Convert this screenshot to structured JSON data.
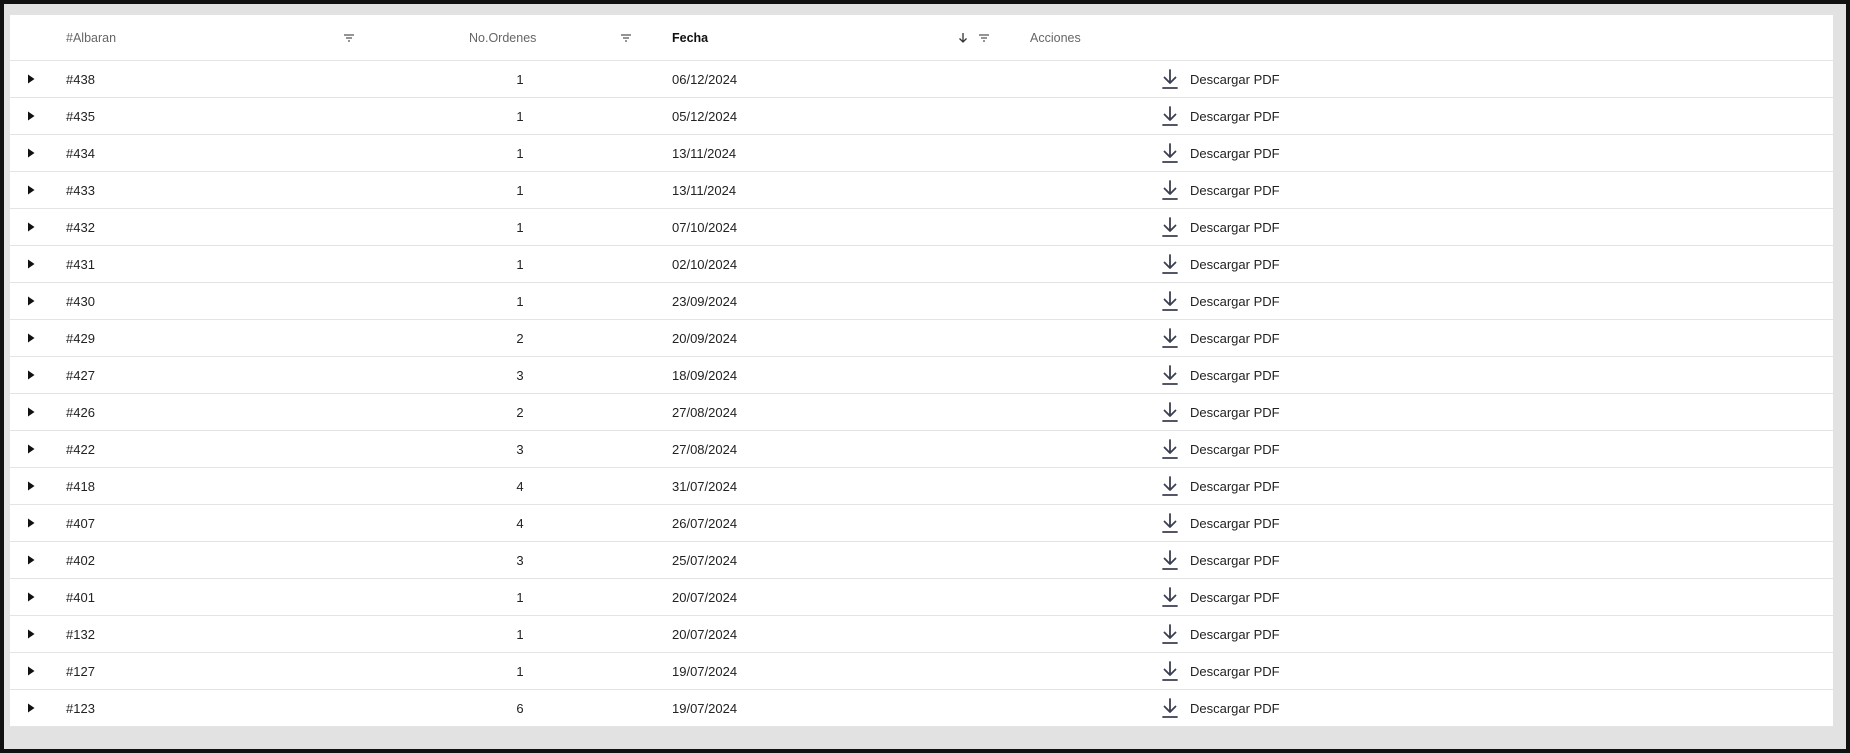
{
  "table": {
    "columns": {
      "albaran": "#Albaran",
      "ordenes": "No.Ordenes",
      "fecha": "Fecha",
      "acciones": "Acciones"
    },
    "sort": {
      "column": "fecha",
      "direction": "descending"
    },
    "action_label": "Descargar PDF",
    "rows": [
      {
        "albaran": "#438",
        "ordenes": "1",
        "fecha": "06/12/2024"
      },
      {
        "albaran": "#435",
        "ordenes": "1",
        "fecha": "05/12/2024"
      },
      {
        "albaran": "#434",
        "ordenes": "1",
        "fecha": "13/11/2024"
      },
      {
        "albaran": "#433",
        "ordenes": "1",
        "fecha": "13/11/2024"
      },
      {
        "albaran": "#432",
        "ordenes": "1",
        "fecha": "07/10/2024"
      },
      {
        "albaran": "#431",
        "ordenes": "1",
        "fecha": "02/10/2024"
      },
      {
        "albaran": "#430",
        "ordenes": "1",
        "fecha": "23/09/2024"
      },
      {
        "albaran": "#429",
        "ordenes": "2",
        "fecha": "20/09/2024"
      },
      {
        "albaran": "#427",
        "ordenes": "3",
        "fecha": "18/09/2024"
      },
      {
        "albaran": "#426",
        "ordenes": "2",
        "fecha": "27/08/2024"
      },
      {
        "albaran": "#422",
        "ordenes": "3",
        "fecha": "27/08/2024"
      },
      {
        "albaran": "#418",
        "ordenes": "4",
        "fecha": "31/07/2024"
      },
      {
        "albaran": "#407",
        "ordenes": "4",
        "fecha": "26/07/2024"
      },
      {
        "albaran": "#402",
        "ordenes": "3",
        "fecha": "25/07/2024"
      },
      {
        "albaran": "#401",
        "ordenes": "1",
        "fecha": "20/07/2024"
      },
      {
        "albaran": "#132",
        "ordenes": "1",
        "fecha": "20/07/2024"
      },
      {
        "albaran": "#127",
        "ordenes": "1",
        "fecha": "19/07/2024"
      },
      {
        "albaran": "#123",
        "ordenes": "6",
        "fecha": "19/07/2024"
      }
    ]
  },
  "icons": {
    "expand": "caret-right-icon",
    "filter": "filter-icon",
    "sort": "arrow-down-icon",
    "download": "download-icon"
  },
  "colors": {
    "icon": "#3a3f52",
    "header_text": "#666666",
    "sorted_header_text": "#111111",
    "row_divider": "#e4e4e4"
  }
}
